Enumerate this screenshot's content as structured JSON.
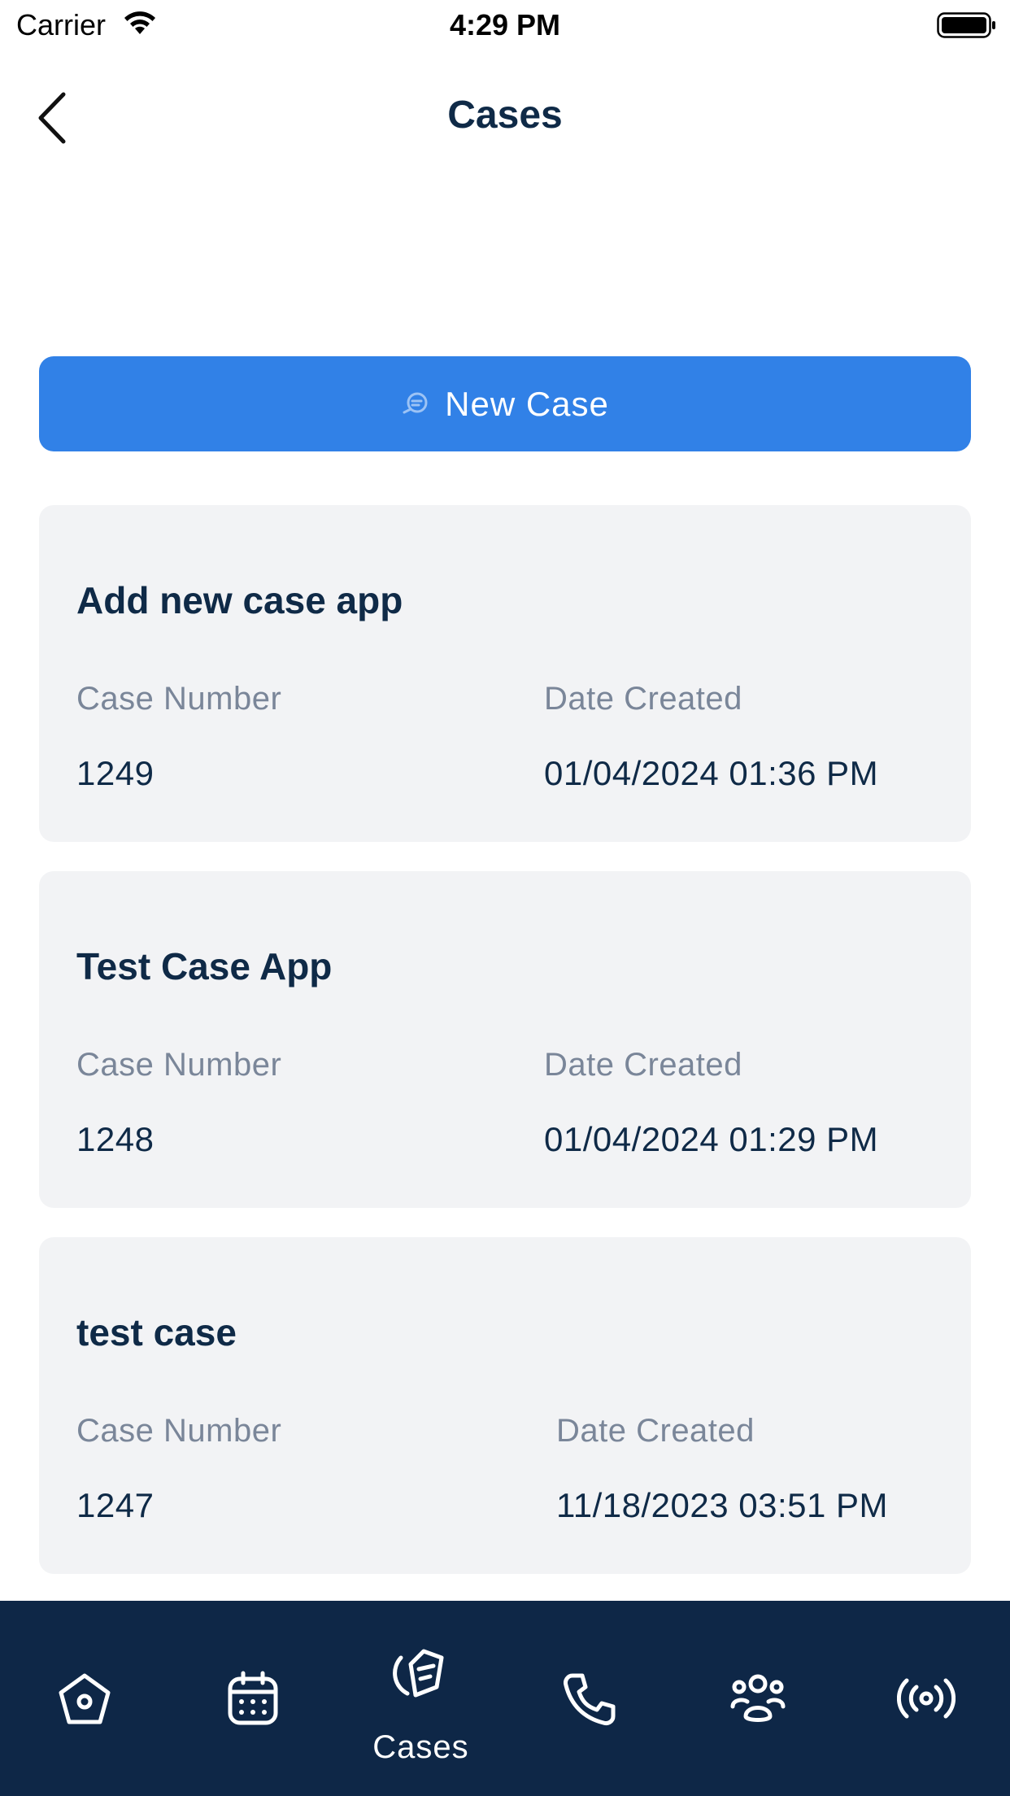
{
  "status_bar": {
    "carrier": "Carrier",
    "time": "4:29 PM"
  },
  "header": {
    "title": "Cases"
  },
  "new_case_button": {
    "label": "New Case",
    "color": "#3181e7"
  },
  "cases": [
    {
      "title": "Add new case app",
      "case_number_label": "Case Number",
      "case_number": "1249",
      "date_label": "Date Created",
      "date_created": "01/04/2024 01:36 PM"
    },
    {
      "title": "Test Case App",
      "case_number_label": "Case Number",
      "case_number": "1248",
      "date_label": "Date Created",
      "date_created": "01/04/2024 01:29 PM"
    },
    {
      "title": "test case",
      "case_number_label": "Case Number",
      "case_number": "1247",
      "date_label": "Date Created",
      "date_created": "11/18/2023 03:51 PM"
    }
  ],
  "tab_bar": {
    "background": "#0e2747",
    "tabs": [
      {
        "icon": "home-icon",
        "label": ""
      },
      {
        "icon": "calendar-icon",
        "label": ""
      },
      {
        "icon": "cases-icon",
        "label": "Cases",
        "active": true
      },
      {
        "icon": "phone-icon",
        "label": ""
      },
      {
        "icon": "people-icon",
        "label": ""
      },
      {
        "icon": "broadcast-icon",
        "label": ""
      }
    ]
  }
}
